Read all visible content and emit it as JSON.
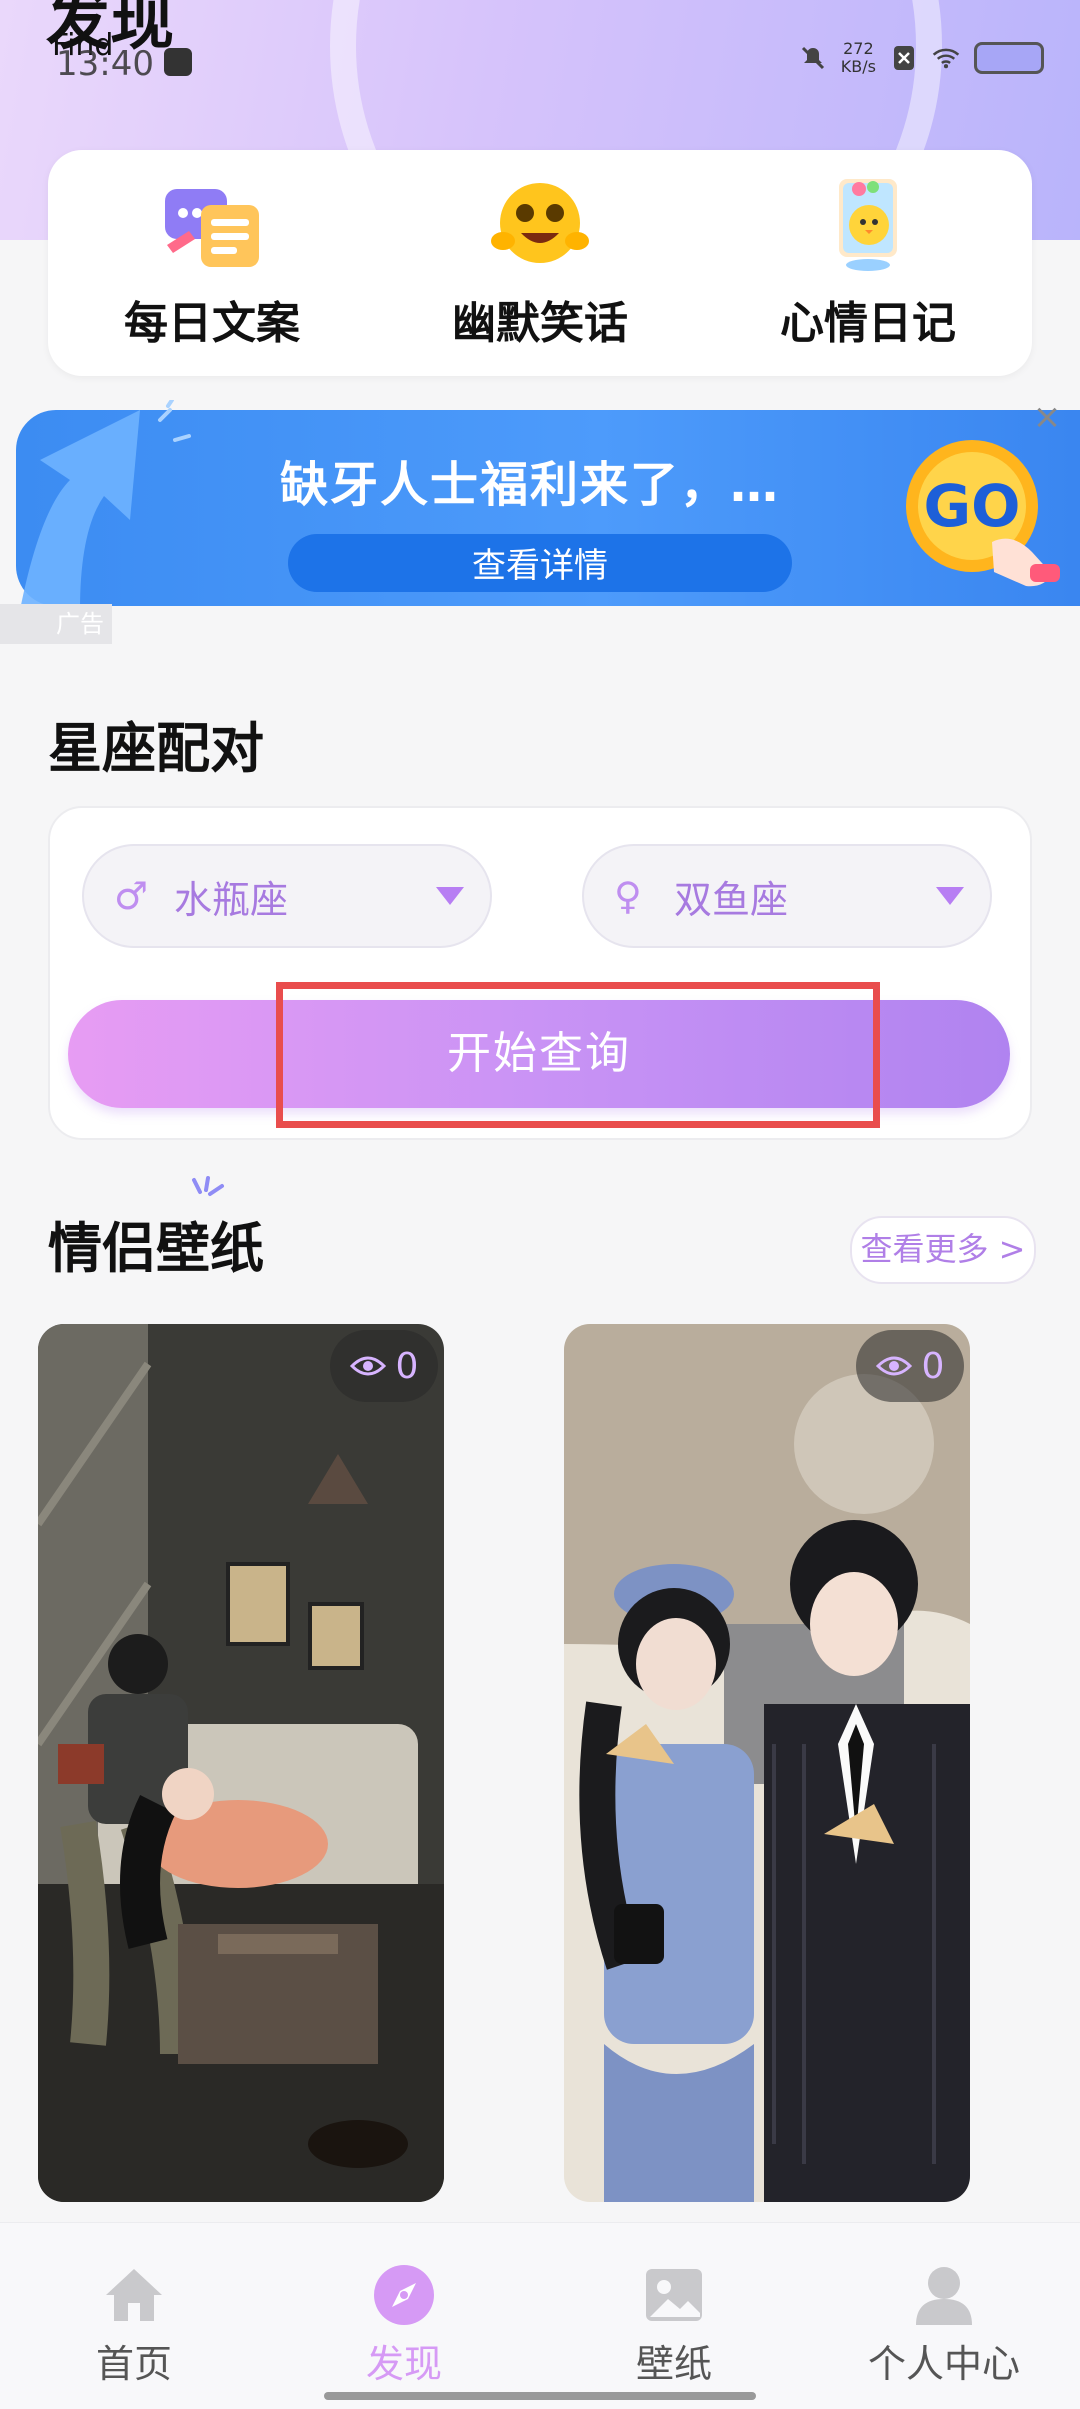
{
  "header": {
    "title": "发现",
    "subtitle": "Find"
  },
  "status_bar": {
    "time": "13:40",
    "net_speed_value": "272",
    "net_speed_unit": "KB/s"
  },
  "quick_links": [
    {
      "label": "每日文案",
      "icon": "chat-cards-icon"
    },
    {
      "label": "幽默笑话",
      "icon": "laughing-emoji-icon"
    },
    {
      "label": "心情日记",
      "icon": "diary-chick-icon"
    }
  ],
  "ad": {
    "title": "缺牙人士福利来了，…",
    "detail_button": "查看详情",
    "go_label": "GO",
    "tag": "广告",
    "close": "×"
  },
  "zodiac": {
    "section_title": "星座配对",
    "male_symbol": "♂",
    "male_sign": "水瓶座",
    "female_symbol": "♀",
    "female_sign": "双鱼座",
    "query_button": "开始查询"
  },
  "wallpapers": {
    "section_title": "情侣壁纸",
    "more_button": "查看更多 >",
    "items": [
      {
        "views": "0",
        "icon": "couple-reading-image"
      },
      {
        "views": "0",
        "icon": "couple-street-image"
      }
    ]
  },
  "bottom_nav": [
    {
      "label": "首页",
      "icon": "home-icon",
      "active": false
    },
    {
      "label": "发现",
      "icon": "compass-icon",
      "active": true
    },
    {
      "label": "壁纸",
      "icon": "picture-icon",
      "active": false
    },
    {
      "label": "个人中心",
      "icon": "person-icon",
      "active": false
    }
  ],
  "colors": {
    "accent": "#d69af5",
    "button_gradient_start": "#e79cf3",
    "button_gradient_end": "#b083f0",
    "ad_blue": "#3c8cf2",
    "highlight": "#e94d4d"
  }
}
